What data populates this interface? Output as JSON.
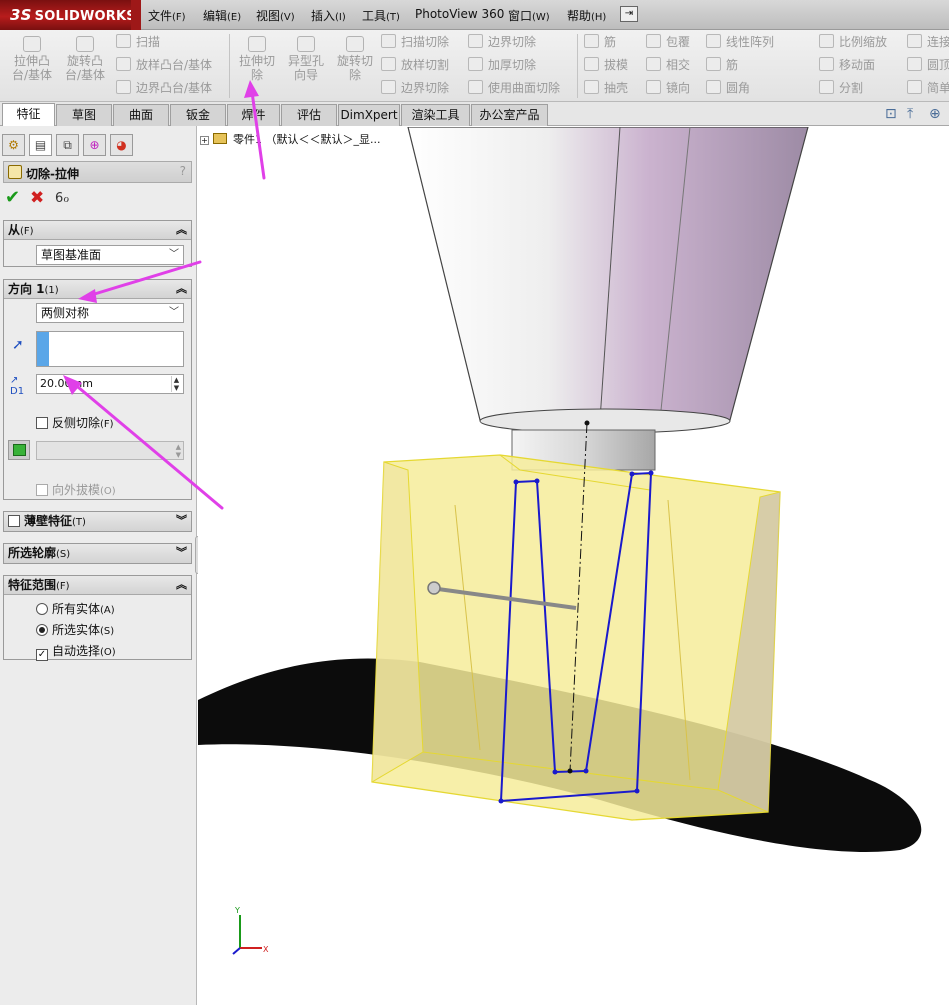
{
  "app": {
    "logo": "SOLIDWORKS",
    "logo_prefix": "3S"
  },
  "menu": [
    {
      "label": "文件",
      "acc": "(F)"
    },
    {
      "label": "编辑",
      "acc": "(E)"
    },
    {
      "label": "视图",
      "acc": "(V)"
    },
    {
      "label": "插入",
      "acc": "(I)"
    },
    {
      "label": "工具",
      "acc": "(T)"
    },
    {
      "label": "PhotoView 360",
      "acc": ""
    },
    {
      "label": "窗口",
      "acc": "(W)"
    },
    {
      "label": "帮助",
      "acc": "(H)"
    }
  ],
  "toolbar": {
    "big": [
      {
        "line1": "拉伸凸",
        "line2": "台/基体"
      },
      {
        "line1": "旋转凸",
        "line2": "台/基体"
      },
      {
        "line1": "拉伸切",
        "line2": "除"
      },
      {
        "line1": "异型孔",
        "line2": "向导"
      },
      {
        "line1": "旋转切",
        "line2": "除"
      }
    ],
    "small": [
      "扫描",
      "放样凸台/基体",
      "边界凸台/基体",
      "扫描切除",
      "放样切割",
      "边界切除",
      "边界切除",
      "加厚切除",
      "使用曲面切除",
      "筋",
      "拔模",
      "抽壳",
      "包覆",
      "相交",
      "镜向",
      "线性阵列",
      "筋",
      "圆角",
      "比例缩放",
      "移动面",
      "分割",
      "连接",
      "圆顶",
      "简单"
    ]
  },
  "tabs": [
    "特征",
    "草图",
    "曲面",
    "钣金",
    "焊件",
    "评估",
    "DimXpert",
    "渲染工具",
    "办公室产品"
  ],
  "tree": {
    "node_label": "零件1 （默认＜＜默认＞_显..."
  },
  "property_manager": {
    "title": "切除-拉伸",
    "help": "?",
    "from_group": {
      "label": "从",
      "acc": "(F)",
      "value": "草图基准面"
    },
    "direction_group": {
      "label": "方向 1",
      "acc": "(1)",
      "end_condition": "两侧对称",
      "depth_value": "20.00mm",
      "depth_label": "D1",
      "flip_side_label": "反侧切除",
      "flip_side_acc": "(F)",
      "flip_side_checked": false,
      "draft_outward_label": "向外拔模",
      "draft_outward_acc": "(O)",
      "draft_outward_checked": false
    },
    "thin_feature": {
      "label": "薄壁特征",
      "acc": "(T)",
      "checked": false
    },
    "selected_contours": {
      "label": "所选轮廓",
      "acc": "(S)"
    },
    "feature_scope": {
      "label": "特征范围",
      "acc": "(F)",
      "options": [
        {
          "label": "所有实体",
          "acc": "(A)",
          "selected": false
        },
        {
          "label": "所选实体",
          "acc": "(S)",
          "selected": true
        }
      ],
      "auto_select_label": "自动选择",
      "auto_select_acc": "(O)",
      "auto_select_checked": true
    }
  },
  "colors": {
    "annotation_arrow": "#e040e8",
    "sketch_blue": "#1a1acc",
    "body_yellow": "#f6ec9a",
    "tool_purple": "#cbb3cf"
  }
}
